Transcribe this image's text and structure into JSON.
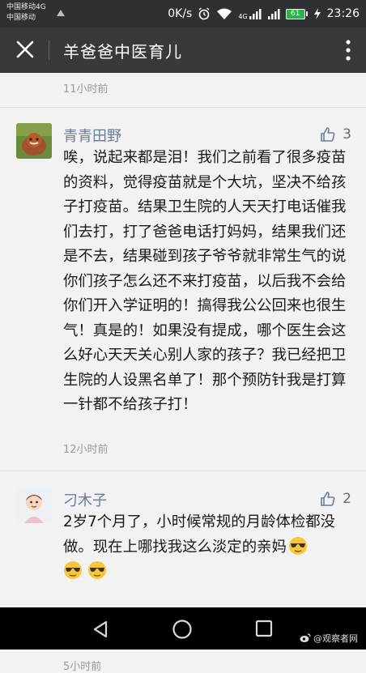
{
  "status_bar": {
    "carrier_1": "中国移动4G",
    "carrier_2": "中国移动",
    "speed": "0K/s",
    "network": "4G",
    "battery": "61",
    "time": "23:26"
  },
  "app_bar": {
    "title": "羊爸爸中医育儿"
  },
  "top_time": "11小时前",
  "comments": [
    {
      "username": "青青田野",
      "likes": "3",
      "text": "唉，说起来都是泪！我们之前看了很多疫苗的资料，觉得疫苗就是个大坑，坚决不给孩子打疫苗。结果卫生院的人天天打电话催我们去打，打了爸爸电话打妈妈，结果我们还是不去，结果碰到孩子爷爷就非常生气的说你们孩子怎么还不来打疫苗，以后我不会给你们开入学证明的！搞得我公公回来也很生气！真是的！如果没有提成，哪个医生会这么好心天天关心别人家的孩子？我已经把卫生院的人设黑名单了！那个预防针我是打算一针都不给孩子打！",
      "time": "12小时前"
    },
    {
      "username": "刁木子",
      "likes": "2",
      "text": "2岁7个月了，小时候常规的月龄体检都没做。现在上哪找我这么淡定的亲妈",
      "time": "5小时前"
    }
  ],
  "watermark": "@观察者网",
  "colors": {
    "status_bar": "#2f3033",
    "app_bar": "#39393b",
    "username": "#6b7d9b",
    "battery": "#2bb34a"
  }
}
